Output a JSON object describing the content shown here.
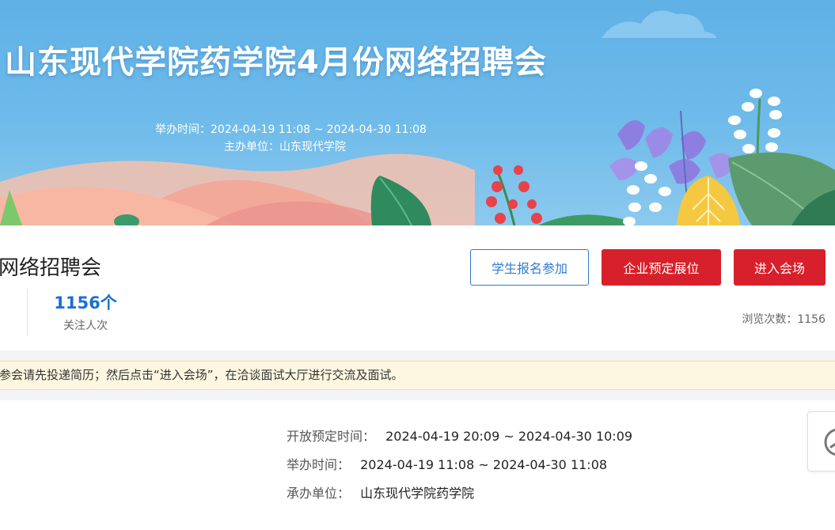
{
  "banner": {
    "title": "山东现代学院药学院4月份网络招聘会",
    "time_label": "举办时间：",
    "time_value": "2024-04-19 11:08 ~ 2024-04-30 11:08",
    "organizer_label": "主办单位：",
    "organizer_value": "山东现代学院"
  },
  "info": {
    "fair_name": "网络招聘会",
    "stat_value": "1156个",
    "stat_label": "关注人次",
    "view_count_label": "浏览次数：",
    "view_count_value": "1156"
  },
  "buttons": {
    "student_signup": "学生报名参加",
    "company_booth": "企业预定展位",
    "enter_venue": "进入会场"
  },
  "notice": {
    "text": "参会请先投递简历；然后点击“进入会场”，在洽谈面试大厅进行交流及面试。"
  },
  "details": {
    "booking_label": "开放预定时间：",
    "booking_value": "2024-04-19 20:09 ~ 2024-04-30 10:09",
    "hold_label": "举办时间：",
    "hold_value": "2024-04-19 11:08 ~ 2024-04-30 11:08",
    "host_label": "承办单位：",
    "host_value": "山东现代学院药学院"
  },
  "colors": {
    "primary_blue": "#1c6fcf",
    "accent_red": "#d7202b",
    "banner_sky": "#5fb1e6",
    "notice_bg": "#fdf7e1"
  },
  "icons": {
    "side_tab": "clock-icon"
  }
}
